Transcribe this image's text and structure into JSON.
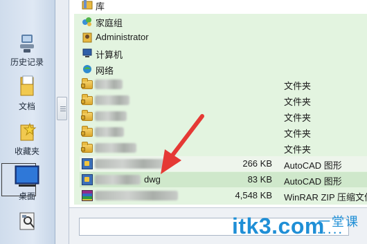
{
  "places": [
    {
      "label": "历史记录",
      "icon": "history-icon"
    },
    {
      "label": "文档",
      "icon": "documents-icon"
    },
    {
      "label": "收藏夹",
      "icon": "favorites-icon"
    },
    {
      "label": "桌面",
      "icon": "desktop-icon",
      "selected": true
    },
    {
      "label": "",
      "icon": "computer-search-icon"
    }
  ],
  "nav_items": [
    {
      "name": "库",
      "icon": "library-icon"
    },
    {
      "name": "家庭组",
      "icon": "homegroup-icon"
    },
    {
      "name": "Administrator",
      "icon": "user-folder-icon"
    },
    {
      "name": "计算机",
      "icon": "computer-icon"
    },
    {
      "name": "网络",
      "icon": "network-icon"
    }
  ],
  "files": [
    {
      "name": "",
      "size": "",
      "type": "文件夹",
      "icon": "folder-icon"
    },
    {
      "name": "",
      "size": "",
      "type": "文件夹",
      "icon": "folder-icon"
    },
    {
      "name": "",
      "size": "",
      "type": "文件夹",
      "icon": "folder-icon"
    },
    {
      "name": "",
      "size": "",
      "type": "文件夹",
      "icon": "folder-icon"
    },
    {
      "name": "",
      "size": "",
      "type": "文件夹",
      "icon": "folder-icon"
    },
    {
      "name": "",
      "size": "266 KB",
      "type": "AutoCAD 图形",
      "icon": "dwg-file-icon"
    },
    {
      "name": "dwg",
      "size": "83 KB",
      "type": "AutoCAD 图形",
      "icon": "dwg-file-icon"
    },
    {
      "name": "",
      "size": "4,548 KB",
      "type": "WinRAR ZIP 压缩文件",
      "icon": "rar-file-icon"
    }
  ],
  "watermark": {
    "brand": "itk3.com",
    "sub": "一堂课",
    "dots": "• • • • •"
  },
  "colors": {
    "list_bg": "#e3f4e0",
    "arrow": "#e53935",
    "watermark": "#1f8fd6"
  }
}
